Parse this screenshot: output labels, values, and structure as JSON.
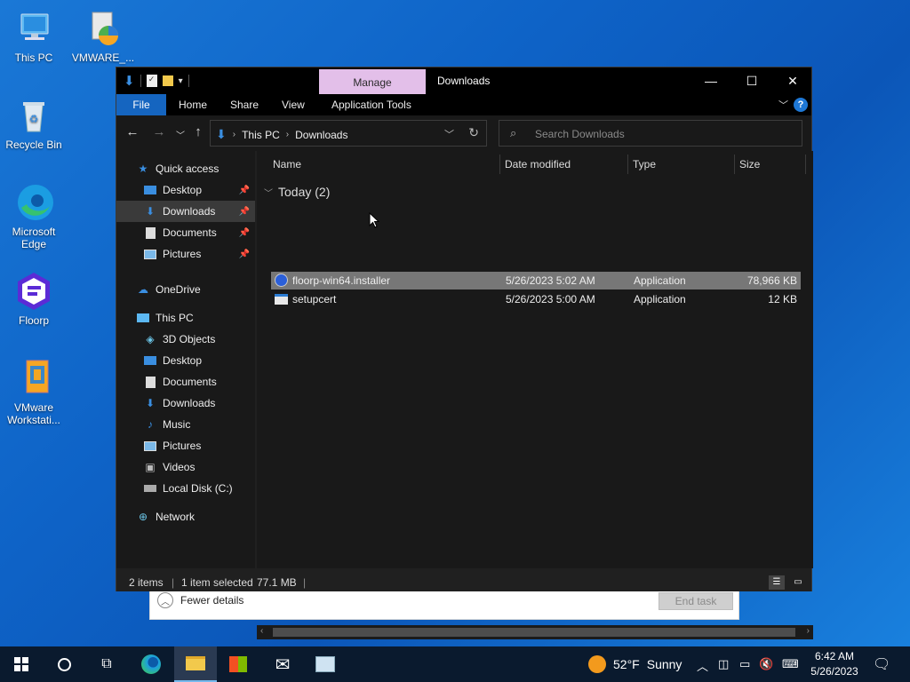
{
  "desktop": {
    "icons": [
      {
        "label": "This PC",
        "icon": "this-pc-icon"
      },
      {
        "label": "VMWARE_...",
        "icon": "vmware-installer-icon"
      },
      {
        "label": "Recycle Bin",
        "icon": "recycle-bin-icon"
      },
      {
        "label": "Microsoft Edge",
        "icon": "edge-icon"
      },
      {
        "label": "Floorp",
        "icon": "floorp-icon"
      },
      {
        "label": "VMware Workstati...",
        "icon": "vmware-workstation-icon"
      }
    ]
  },
  "task_manager": {
    "fewer_details": "Fewer details",
    "end_task": "End task"
  },
  "explorer": {
    "title": "Downloads",
    "manage_tab": "Manage",
    "ribbon_tabs": [
      "File",
      "Home",
      "Share",
      "View",
      "Application Tools"
    ],
    "breadcrumb": [
      "This PC",
      "Downloads"
    ],
    "search_placeholder": "Search Downloads",
    "nav": {
      "quick_access": "Quick access",
      "quick_items": [
        "Desktop",
        "Downloads",
        "Documents",
        "Pictures"
      ],
      "onedrive": "OneDrive",
      "this_pc": "This PC",
      "pc_items": [
        "3D Objects",
        "Desktop",
        "Documents",
        "Downloads",
        "Music",
        "Pictures",
        "Videos",
        "Local Disk (C:)"
      ],
      "network": "Network"
    },
    "columns": [
      "Name",
      "Date modified",
      "Type",
      "Size"
    ],
    "group_label": "Today (2)",
    "files": [
      {
        "name": "floorp-win64.installer",
        "date": "5/26/2023 5:02 AM",
        "type": "Application",
        "size": "78,966 KB",
        "selected": true
      },
      {
        "name": "setupcert",
        "date": "5/26/2023 5:00 AM",
        "type": "Application",
        "size": "12 KB",
        "selected": false
      }
    ],
    "status": {
      "items": "2 items",
      "selected": "1 item selected",
      "size": "77.1 MB"
    }
  },
  "taskbar": {
    "weather_temp": "52°F",
    "weather_cond": "Sunny",
    "time": "6:42 AM",
    "date": "5/26/2023"
  },
  "colors": {
    "desktop_bg": "#0e63c7",
    "accent": "#1565c0",
    "manage_tab": "#e3bfe9",
    "selected_row": "#777777"
  }
}
